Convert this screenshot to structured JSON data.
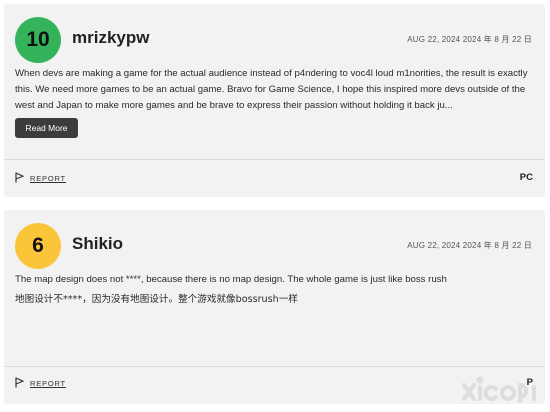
{
  "reviews": [
    {
      "score": "10",
      "score_color": "#34b35a",
      "username": "mrizkypw",
      "date": "AUG 22, 2024  2024 年 8 月 22 日",
      "text": "When devs are making a game for the actual audience instead of p4ndering to voc4l loud m1norities, the result is exactly this. We need more games to be an actual game. Bravo for Game Science, I hope this inspired more devs outside of the west and Japan to make more games and be brave to express their passion without holding it back ju...",
      "read_more_label": "Read More",
      "report_label": "REPORT",
      "platform": "PC"
    },
    {
      "score": "6",
      "score_color": "#fbc53a",
      "username": "Shikio",
      "date": "AUG 22, 2024  2024 年 8 月 22 日",
      "text": "The map design does not ****, because there is no map design. The whole game is just like boss rush",
      "text_cn": "地图设计不****，因为没有地图设计。整个游戏就像bossrush一样",
      "report_label": "REPORT",
      "platform": "P"
    }
  ]
}
